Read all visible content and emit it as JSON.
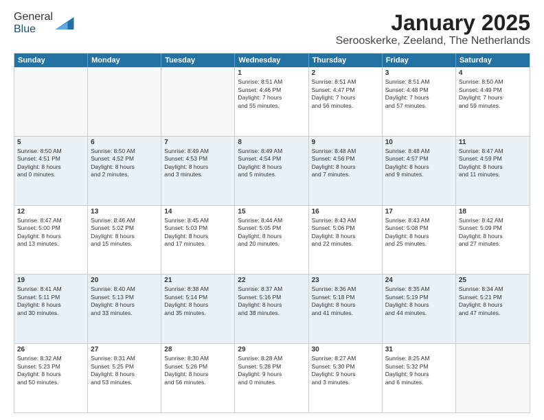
{
  "logo": {
    "general": "General",
    "blue": "Blue"
  },
  "title": "January 2025",
  "subtitle": "Serooskerke, Zeeland, The Netherlands",
  "header_days": [
    "Sunday",
    "Monday",
    "Tuesday",
    "Wednesday",
    "Thursday",
    "Friday",
    "Saturday"
  ],
  "weeks": [
    [
      {
        "day": "",
        "info": ""
      },
      {
        "day": "",
        "info": ""
      },
      {
        "day": "",
        "info": ""
      },
      {
        "day": "1",
        "info": "Sunrise: 8:51 AM\nSunset: 4:46 PM\nDaylight: 7 hours\nand 55 minutes."
      },
      {
        "day": "2",
        "info": "Sunrise: 8:51 AM\nSunset: 4:47 PM\nDaylight: 7 hours\nand 56 minutes."
      },
      {
        "day": "3",
        "info": "Sunrise: 8:51 AM\nSunset: 4:48 PM\nDaylight: 7 hours\nand 57 minutes."
      },
      {
        "day": "4",
        "info": "Sunrise: 8:50 AM\nSunset: 4:49 PM\nDaylight: 7 hours\nand 59 minutes."
      }
    ],
    [
      {
        "day": "5",
        "info": "Sunrise: 8:50 AM\nSunset: 4:51 PM\nDaylight: 8 hours\nand 0 minutes."
      },
      {
        "day": "6",
        "info": "Sunrise: 8:50 AM\nSunset: 4:52 PM\nDaylight: 8 hours\nand 2 minutes."
      },
      {
        "day": "7",
        "info": "Sunrise: 8:49 AM\nSunset: 4:53 PM\nDaylight: 8 hours\nand 3 minutes."
      },
      {
        "day": "8",
        "info": "Sunrise: 8:49 AM\nSunset: 4:54 PM\nDaylight: 8 hours\nand 5 minutes."
      },
      {
        "day": "9",
        "info": "Sunrise: 8:48 AM\nSunset: 4:56 PM\nDaylight: 8 hours\nand 7 minutes."
      },
      {
        "day": "10",
        "info": "Sunrise: 8:48 AM\nSunset: 4:57 PM\nDaylight: 8 hours\nand 9 minutes."
      },
      {
        "day": "11",
        "info": "Sunrise: 8:47 AM\nSunset: 4:59 PM\nDaylight: 8 hours\nand 11 minutes."
      }
    ],
    [
      {
        "day": "12",
        "info": "Sunrise: 8:47 AM\nSunset: 5:00 PM\nDaylight: 8 hours\nand 13 minutes."
      },
      {
        "day": "13",
        "info": "Sunrise: 8:46 AM\nSunset: 5:02 PM\nDaylight: 8 hours\nand 15 minutes."
      },
      {
        "day": "14",
        "info": "Sunrise: 8:45 AM\nSunset: 5:03 PM\nDaylight: 8 hours\nand 17 minutes."
      },
      {
        "day": "15",
        "info": "Sunrise: 8:44 AM\nSunset: 5:05 PM\nDaylight: 8 hours\nand 20 minutes."
      },
      {
        "day": "16",
        "info": "Sunrise: 8:43 AM\nSunset: 5:06 PM\nDaylight: 8 hours\nand 22 minutes."
      },
      {
        "day": "17",
        "info": "Sunrise: 8:43 AM\nSunset: 5:08 PM\nDaylight: 8 hours\nand 25 minutes."
      },
      {
        "day": "18",
        "info": "Sunrise: 8:42 AM\nSunset: 5:09 PM\nDaylight: 8 hours\nand 27 minutes."
      }
    ],
    [
      {
        "day": "19",
        "info": "Sunrise: 8:41 AM\nSunset: 5:11 PM\nDaylight: 8 hours\nand 30 minutes."
      },
      {
        "day": "20",
        "info": "Sunrise: 8:40 AM\nSunset: 5:13 PM\nDaylight: 8 hours\nand 33 minutes."
      },
      {
        "day": "21",
        "info": "Sunrise: 8:38 AM\nSunset: 5:14 PM\nDaylight: 8 hours\nand 35 minutes."
      },
      {
        "day": "22",
        "info": "Sunrise: 8:37 AM\nSunset: 5:16 PM\nDaylight: 8 hours\nand 38 minutes."
      },
      {
        "day": "23",
        "info": "Sunrise: 8:36 AM\nSunset: 5:18 PM\nDaylight: 8 hours\nand 41 minutes."
      },
      {
        "day": "24",
        "info": "Sunrise: 8:35 AM\nSunset: 5:19 PM\nDaylight: 8 hours\nand 44 minutes."
      },
      {
        "day": "25",
        "info": "Sunrise: 8:34 AM\nSunset: 5:21 PM\nDaylight: 8 hours\nand 47 minutes."
      }
    ],
    [
      {
        "day": "26",
        "info": "Sunrise: 8:32 AM\nSunset: 5:23 PM\nDaylight: 8 hours\nand 50 minutes."
      },
      {
        "day": "27",
        "info": "Sunrise: 8:31 AM\nSunset: 5:25 PM\nDaylight: 8 hours\nand 53 minutes."
      },
      {
        "day": "28",
        "info": "Sunrise: 8:30 AM\nSunset: 5:26 PM\nDaylight: 8 hours\nand 56 minutes."
      },
      {
        "day": "29",
        "info": "Sunrise: 8:28 AM\nSunset: 5:28 PM\nDaylight: 9 hours\nand 0 minutes."
      },
      {
        "day": "30",
        "info": "Sunrise: 8:27 AM\nSunset: 5:30 PM\nDaylight: 9 hours\nand 3 minutes."
      },
      {
        "day": "31",
        "info": "Sunrise: 8:25 AM\nSunset: 5:32 PM\nDaylight: 9 hours\nand 6 minutes."
      },
      {
        "day": "",
        "info": ""
      }
    ]
  ]
}
